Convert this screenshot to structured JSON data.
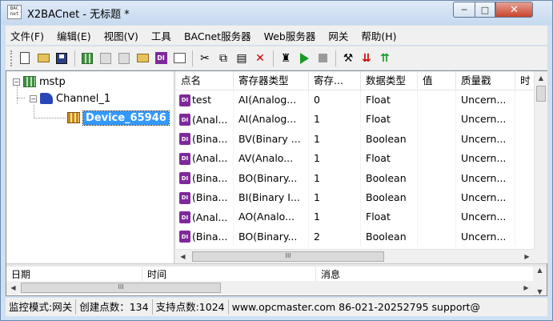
{
  "window": {
    "app_icon_text": "BAC net",
    "title": "X2BACnet - 无标题 *",
    "minimize_glyph": "─",
    "maximize_glyph": "□",
    "close_glyph": "✕"
  },
  "menu": [
    "文件(F)",
    "编辑(E)",
    "视图(V)",
    "工具",
    "BACnet服务器",
    "Web服务器",
    "网关",
    "帮助(H)"
  ],
  "toolbar": {
    "icons": [
      "new-document-icon",
      "open-folder-icon",
      "save-icon",
      "add-channel-icon",
      "add-device-icon",
      "add-group-icon",
      "add-tag-icon",
      "add-point-icon",
      "properties-icon",
      "cut-icon",
      "copy-icon",
      "paste-icon",
      "delete-icon",
      "monitor-icon",
      "start-icon",
      "stop-icon",
      "tools-icon",
      "load-icon",
      "up-icon"
    ],
    "glyphs": {
      "cut": "✂",
      "copy": "⧉",
      "paste": "▤",
      "delete": "✕",
      "monitor": "♜",
      "tools": "⚒",
      "load": "⇊",
      "up": "⇈"
    }
  },
  "tree": {
    "root": {
      "label": "mstp",
      "expander": "−"
    },
    "channel": {
      "label": "Channel_1",
      "expander": "−"
    },
    "device": {
      "label": "Device_65946"
    }
  },
  "list": {
    "columns": [
      "点名",
      "寄存器类型",
      "寄存...",
      "数据类型",
      "值",
      "质量戳",
      "时"
    ],
    "rows": [
      {
        "name": "test",
        "register": "AI(Analog...",
        "reg": "0",
        "dtype": "Float",
        "value": "",
        "quality": "Uncern..."
      },
      {
        "name": "(Anal...",
        "register": "AI(Analog...",
        "reg": "1",
        "dtype": "Float",
        "value": "",
        "quality": "Uncern..."
      },
      {
        "name": "(Bina...",
        "register": "BV(Binary ...",
        "reg": "1",
        "dtype": "Boolean",
        "value": "",
        "quality": "Uncern..."
      },
      {
        "name": "(Anal...",
        "register": "AV(Analo...",
        "reg": "1",
        "dtype": "Float",
        "value": "",
        "quality": "Uncern..."
      },
      {
        "name": "(Bina...",
        "register": "BO(Binary...",
        "reg": "1",
        "dtype": "Boolean",
        "value": "",
        "quality": "Uncern..."
      },
      {
        "name": "(Bina...",
        "register": "BI(Binary I...",
        "reg": "1",
        "dtype": "Boolean",
        "value": "",
        "quality": "Uncern..."
      },
      {
        "name": "(Anal...",
        "register": "AO(Analo...",
        "reg": "1",
        "dtype": "Float",
        "value": "",
        "quality": "Uncern..."
      },
      {
        "name": "(Bina...",
        "register": "BO(Binary...",
        "reg": "2",
        "dtype": "Boolean",
        "value": "",
        "quality": "Uncern..."
      }
    ],
    "row_icon_text": "DI",
    "scroll": {
      "up": "▲",
      "left": "◀",
      "right": "▶",
      "grip": "III"
    }
  },
  "log": {
    "columns": [
      "日期",
      "时间",
      "消息"
    ],
    "scroll": {
      "up": "▲",
      "down": "▼",
      "left": "◀",
      "right": "▶",
      "grip": "III"
    }
  },
  "status": {
    "mode": "监控模式:网关",
    "created": "创建点数：134",
    "supported": "支持点数:1024",
    "contact": "www.opcmaster.com 86-021-20252795 support@"
  }
}
